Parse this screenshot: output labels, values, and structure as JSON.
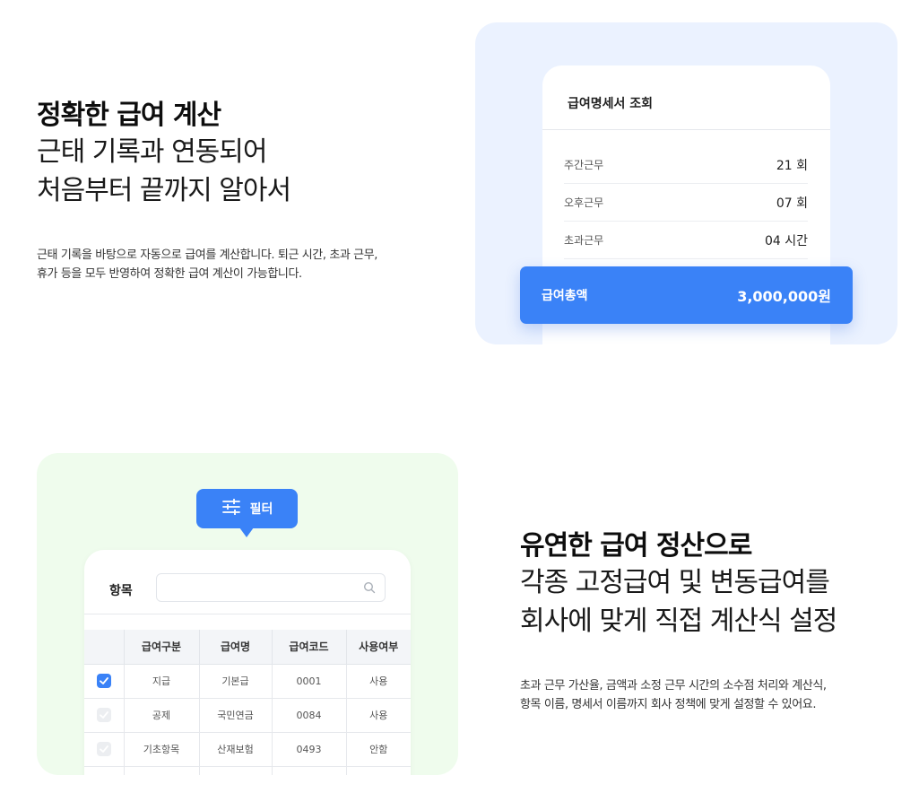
{
  "section1": {
    "title": "정확한 급여 계산",
    "subtitle_lines": [
      "근태 기록과 연동되어",
      "처음부터 끝까지 알아서"
    ],
    "description_lines": [
      "근태 기록을 바탕으로 자동으로 급여를 계산합니다. 퇴근 시간, 초과 근무,",
      "휴가 등을 모두 반영하여 정확한 급여 계산이 가능합니다."
    ],
    "payslip": {
      "title": "급여명세서 조회",
      "rows": [
        {
          "label": "주간근무",
          "value": "21 회"
        },
        {
          "label": "오후근무",
          "value": "07 회"
        },
        {
          "label": "초과근무",
          "value": "04 시간"
        }
      ],
      "total_label": "급여총액",
      "total_value": "3,000,000원"
    }
  },
  "section2": {
    "title": "유연한 급여 정산으로",
    "subtitle_lines": [
      "각종 고정급여 및 변동급여를",
      "회사에 맞게 직접 계산식 설정"
    ],
    "description_lines": [
      "초과 근무 가산율, 금액과 소정 근무 시간의 소수점 처리와 계산식,",
      "항목 이름, 명세서 이름까지 회사 정책에 맞게 설정할 수 있어요."
    ],
    "filter_button": "필터",
    "filter_label": "항목",
    "search_placeholder": "",
    "table": {
      "headers": [
        "",
        "급여구분",
        "급여명",
        "급여코드",
        "사용여부"
      ],
      "rows": [
        {
          "checked": true,
          "type": "지급",
          "name": "기본급",
          "code": "0001",
          "status": "사용"
        },
        {
          "checked": false,
          "type": "공제",
          "name": "국민연금",
          "code": "0084",
          "status": "사용"
        },
        {
          "checked": false,
          "type": "기초항목",
          "name": "산재보험",
          "code": "0493",
          "status": "안함"
        }
      ]
    }
  },
  "colors": {
    "accent": "#3a82f7",
    "panel_blue": "#ebf2ff",
    "panel_green": "#effced",
    "status_on": "#2cae4a",
    "status_off": "#e5484d"
  }
}
